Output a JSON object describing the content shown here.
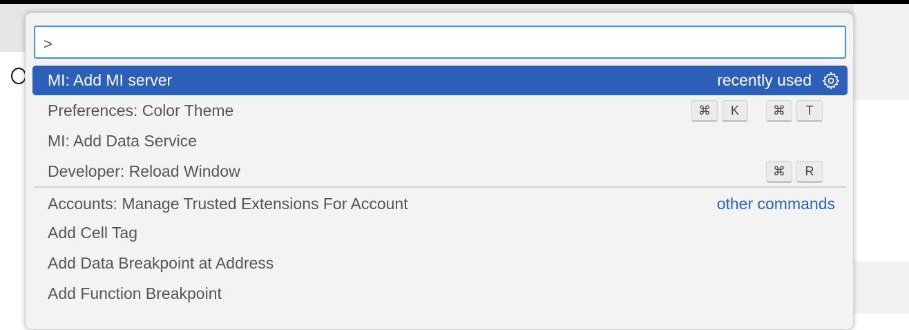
{
  "input": {
    "value": ">"
  },
  "items": [
    {
      "label": "MI: Add MI server",
      "detail": "recently used",
      "selected": true
    },
    {
      "label": "Preferences: Color Theme",
      "keys": [
        [
          "⌘",
          "K"
        ],
        [
          "⌘",
          "T"
        ]
      ]
    },
    {
      "label": "MI: Add Data Service"
    },
    {
      "label": "Developer: Reload Window",
      "keys": [
        [
          "⌘",
          "R"
        ]
      ]
    },
    {
      "label": "Accounts: Manage Trusted Extensions For Account",
      "detail": "other commands"
    },
    {
      "label": "Add Cell Tag"
    },
    {
      "label": "Add Data Breakpoint at Address"
    },
    {
      "label": "Add Function Breakpoint"
    }
  ],
  "colors": {
    "selection": "#2b5fb8",
    "link": "#2b63b8",
    "input_border": "#4a90e2"
  }
}
